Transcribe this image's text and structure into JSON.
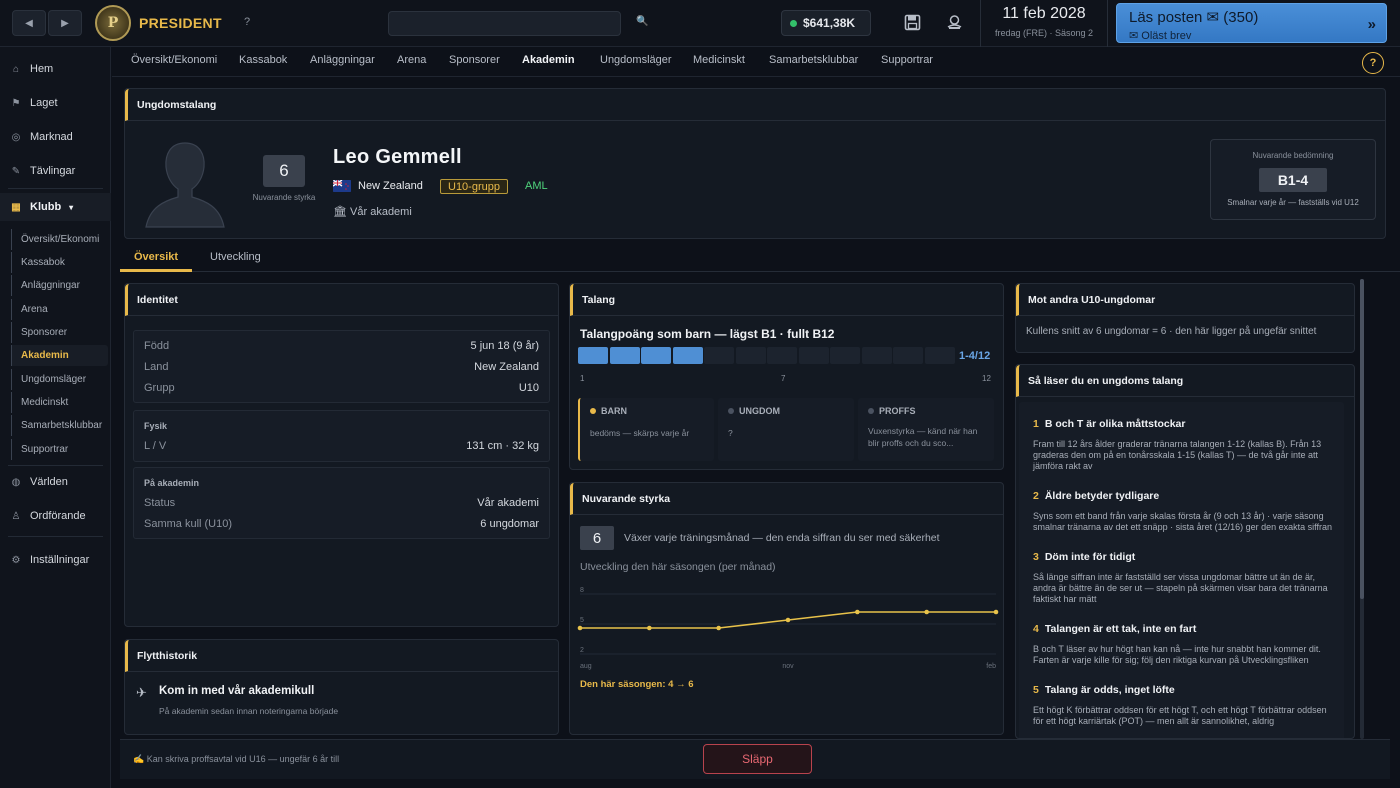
{
  "topbar": {
    "back_icon": "◀",
    "forward_icon": "▶",
    "brand": "PRESIDENT",
    "help": "?",
    "search_placeholder": "",
    "search_icon": "🔍",
    "balance": "$641,38K",
    "date": "11 feb 2028",
    "season": "fredag (FRE) · Säsong 2",
    "mail_title": "Läs posten ✉ (350)",
    "mail_sub": "Oläst brev",
    "mail_arrow": "»"
  },
  "sidebar": {
    "items": [
      {
        "icon": "⌂",
        "label": "Hem"
      },
      {
        "icon": "⚑",
        "label": "Laget"
      },
      {
        "icon": "◎",
        "label": "Marknad"
      },
      {
        "icon": "✎",
        "label": "Tävlingar"
      },
      {
        "icon": "▦",
        "label": "Klubb",
        "caret": "▾"
      },
      {
        "icon": "◍",
        "label": "Världen"
      },
      {
        "icon": "♙",
        "label": "Ordförande"
      },
      {
        "icon": "⚙",
        "label": "Inställningar"
      }
    ],
    "club_sub": [
      "Översikt/Ekonomi",
      "Kassabok",
      "Anläggningar",
      "Arena",
      "Sponsorer",
      "Akademin",
      "Ungdomsläger",
      "Medicinskt",
      "Samarbetsklubbar",
      "Supportrar"
    ]
  },
  "tabs": [
    "Översikt/Ekonomi",
    "Kassabok",
    "Anläggningar",
    "Arena",
    "Sponsorer",
    "Akademin",
    "Ungdomsläger",
    "Medicinskt",
    "Samarbetsklubbar",
    "Supportrar"
  ],
  "help_btn": "?",
  "youth": {
    "header": "Ungdomstalang",
    "strength": "6",
    "strength_label": "Nuvarande styrka",
    "name": "Leo Gemmell",
    "nation": "New Zealand",
    "group": "U10-grupp",
    "position": "AML",
    "academy": "Vår akademi",
    "rating_label": "Nuvarande bedömning",
    "rating": "B1-4",
    "rating_note": "Smalnar varje år — fastställs vid U12"
  },
  "profile_tabs": [
    "Översikt",
    "Utveckling"
  ],
  "identity": {
    "header": "Identitet",
    "rows": [
      {
        "k": "Född",
        "v": "5 jun 18 (9 år)"
      },
      {
        "k": "Land",
        "v": "New Zealand"
      },
      {
        "k": "Grupp",
        "v": "U10"
      }
    ],
    "physical_header": "Fysik",
    "physical": {
      "k": "L / V",
      "v": "131 cm · 32 kg"
    },
    "academy_header": "På akademin",
    "academy_rows": [
      {
        "k": "Status",
        "v": "Vår akademi"
      },
      {
        "k": "Samma kull (U10)",
        "v": "6 ungdomar"
      }
    ]
  },
  "transfer": {
    "header": "Flytthistorik",
    "icon": "✈",
    "title": "Kom in med vår akademikull",
    "sub": "På akademin sedan innan noteringarna började"
  },
  "talent": {
    "header": "Talang",
    "title": "Talangpoäng som barn — lägst B1 · fullt B12",
    "range_label": "1-4/12",
    "range_low": 1,
    "range_high": 4,
    "scale_max": 12,
    "ticks": [
      "1",
      "7",
      "12"
    ],
    "stages": [
      {
        "name": "BARN",
        "desc": "bedöms — skärps varje år",
        "color": "#e8b94a"
      },
      {
        "name": "UNGDOM",
        "desc": "?",
        "color": "#4a5260"
      },
      {
        "name": "PROFFS",
        "desc": "Vuxenstyrka — känd när han blir proffs och du sco...",
        "color": "#4a5260"
      }
    ]
  },
  "current": {
    "header": "Nuvarande styrka",
    "value": "6",
    "desc": "Växer varje träningsmånad — den enda siffran du ser med säkerhet",
    "chart_title": "Utveckling den här säsongen (per månad)",
    "season_note": "Den här säsongen: 4 → 6"
  },
  "chart_data": {
    "type": "line",
    "title": "Utveckling den här säsongen (per månad)",
    "x_ticks": [
      "aug",
      "nov",
      "feb"
    ],
    "y_ticks": [
      2,
      5,
      8
    ],
    "ylim": [
      2,
      8
    ],
    "values": [
      4.6,
      4.6,
      4.6,
      5.4,
      6.2,
      6.2,
      6.2
    ],
    "color": "#e8c24a"
  },
  "compare": {
    "header": "Mot andra U10-ungdomar",
    "text": "Kullens snitt av 6 ungdomar = 6 · den här ligger på ungefär snittet"
  },
  "guide": {
    "header": "Så läser du en ungdoms talang",
    "items": [
      {
        "n": "1",
        "title": "B och T är olika måttstockar",
        "text": "Fram till 12 års ålder graderar tränarna talangen 1-12 (kallas B). Från 13 graderas den om på en tonårsskala 1-15 (kallas T) — de två går inte att jämföra rakt av"
      },
      {
        "n": "2",
        "title": "Äldre betyder tydligare",
        "text": "Syns som ett band från varje skalas första år (9 och 13 år) · varje säsong smalnar tränarna av det ett snäpp · sista året (12/16) ger den exakta siffran"
      },
      {
        "n": "3",
        "title": "Döm inte för tidigt",
        "text": "Så länge siffran inte är fastställd ser vissa ungdomar bättre ut än de är, andra är bättre än de ser ut — stapeln på skärmen visar bara det tränarna faktiskt har mätt"
      },
      {
        "n": "4",
        "title": "Talangen är ett tak, inte en fart",
        "text": "B och T läser av hur högt han kan nå — inte hur snabbt han kommer dit. Farten är varje kille för sig; följ den riktiga kurvan på Utvecklingsfliken"
      },
      {
        "n": "5",
        "title": "Talang är odds, inget löfte",
        "text": "Ett högt K förbättrar oddsen för ett högt T, och ett högt T förbättrar oddsen för ett högt karriärtak (POT) — men allt är sannolikhet, aldrig"
      }
    ]
  },
  "footer": {
    "note_icon": "✍",
    "note": "Kan skriva proffsavtal vid U16 — ungefär 6 år till",
    "release": "Släpp"
  }
}
